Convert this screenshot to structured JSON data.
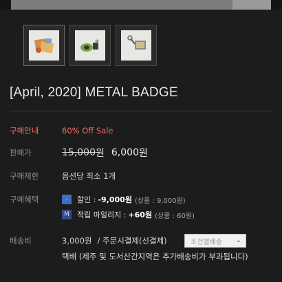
{
  "product": {
    "title": "[April, 2020] METAL BADGE",
    "thumbnails": [
      {
        "icon": "badge-set-image"
      },
      {
        "icon": "badge-green-image"
      },
      {
        "icon": "badge-keyring-image"
      }
    ]
  },
  "info": {
    "notice_label": "구매안내",
    "notice_value": "60% Off Sale",
    "price_label": "판매가",
    "original_price": "15,000",
    "original_price_unit": "원",
    "sale_price": "6,000",
    "sale_price_unit": "원",
    "limit_label": "구매제한",
    "limit_value": "옵션당 최소 1개",
    "benefit_label": "구매혜택",
    "discount_badge": "-",
    "discount_label": "할인 :",
    "discount_amount": "-9,000원",
    "discount_detail": "(상품 : 9,000원)",
    "mileage_badge": "M",
    "mileage_label": "적립 마일리지 :",
    "mileage_amount": "+60원",
    "mileage_detail": "(상품 : 60원)",
    "shipping_label": "배송비",
    "shipping_value": "3,000원",
    "shipping_method": "/ 주문시결제(선결제)",
    "shipping_select": "조건별배송",
    "shipping_note": "택배 (제주 및 도서산간지역은 추가배송비가 부과됩니다)"
  },
  "colors": {
    "background": "#1c1c1c",
    "accent": "#f06a6a",
    "discount_badge": "#3a6fc2",
    "mileage_badge": "#3a4a86"
  }
}
